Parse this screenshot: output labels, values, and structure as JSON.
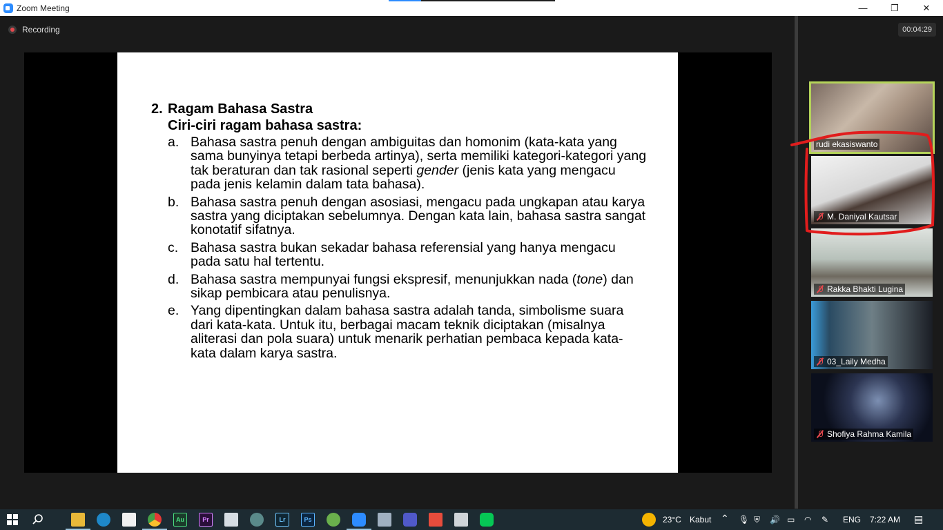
{
  "window": {
    "title": "Zoom Meeting",
    "minimize_glyph": "—",
    "restore_glyph": "❐",
    "close_glyph": "✕"
  },
  "meeting": {
    "recording_label": "Recording",
    "timer": "00:04:29"
  },
  "slide": {
    "number": "2.",
    "title": "Ragam Bahasa Sastra",
    "subtitle": "Ciri-ciri ragam bahasa sastra:",
    "items": [
      {
        "letter": "a.",
        "text": "Bahasa sastra penuh dengan ambiguitas dan homonim (kata-kata yang sama bunyinya tetapi berbeda artinya), serta memiliki kategori-kategori yang tak beraturan dan tak rasional seperti gender (jenis kata yang mengacu pada jenis kelamin dalam tata bahasa)."
      },
      {
        "letter": "b.",
        "text": "Bahasa sastra penuh dengan asosiasi, mengacu pada ungkapan atau karya sastra yang diciptakan sebelumnya. Dengan kata lain, bahasa sastra sangat konotatif sifatnya."
      },
      {
        "letter": "c.",
        "text": "Bahasa sastra bukan sekadar bahasa referensial yang hanya mengacu pada satu hal tertentu."
      },
      {
        "letter": "d.",
        "text": "Bahasa sastra mempunyai fungsi ekspresif, menunjukkan nada (tone) dan sikap pembicara atau penulisnya."
      },
      {
        "letter": "e.",
        "text": "Yang dipentingkan dalam bahasa sastra adalah tanda, simbolisme suara dari kata-kata. Untuk itu, berbagai macam teknik diciptakan (misalnya aliterasi dan pola suara) untuk menarik perhatian pembaca kepada kata-kata dalam karya sastra."
      }
    ]
  },
  "participants": [
    {
      "name": "rudi ekasiswanto",
      "muted": false,
      "speaking": true
    },
    {
      "name": "M. Daniyal Kautsar",
      "muted": true,
      "speaking": false
    },
    {
      "name": "Rakka Bhakti Lugina",
      "muted": true,
      "speaking": false
    },
    {
      "name": "03_Laily Medha",
      "muted": true,
      "speaking": false
    },
    {
      "name": "Shofiya Rahma Kamila",
      "muted": true,
      "speaking": false
    }
  ],
  "annotation_color": "#e11d1d",
  "taskbar": {
    "apps": [
      "windows-start-icon",
      "search-icon",
      "file-explorer-icon",
      "edge-icon",
      "store-icon",
      "chrome-icon",
      "audition-icon",
      "premiere-icon",
      "notes-icon",
      "clock-icon",
      "lightroom-icon",
      "photoshop-icon",
      "utorrent-icon",
      "zoom-icon",
      "network-app-icon",
      "teams-icon",
      "paint-icon",
      "printer-icon",
      "line-icon"
    ],
    "labels": {
      "au": "Au",
      "pr": "Pr",
      "lr": "Lr",
      "ps": "Ps"
    },
    "weather_temp": "23°C",
    "weather_desc": "Kabut",
    "language": "ENG",
    "time": "7:22 AM"
  }
}
